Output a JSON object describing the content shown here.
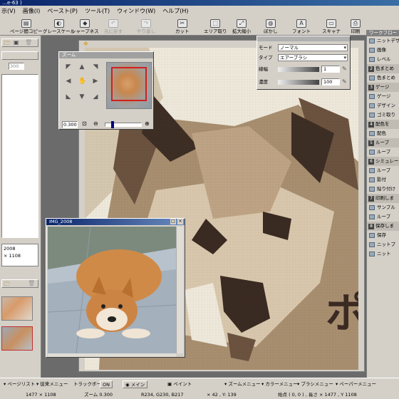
{
  "window": {
    "title": "…e-63 )"
  },
  "menu": [
    "示(V)",
    "画像(I)",
    "ペースト(P)",
    "ツール(T)",
    "ウィンドウ(W)",
    "ヘルプ(H)"
  ],
  "toolbar": {
    "buttons": [
      {
        "label": "ページ間コピー",
        "enabled": true
      },
      {
        "label": "グレースケール",
        "enabled": true
      },
      {
        "label": "シャープネス",
        "enabled": true
      },
      {
        "label": "元に戻す",
        "enabled": false
      },
      {
        "label": "やり直し",
        "enabled": false
      },
      {
        "label": "カット",
        "enabled": true
      },
      {
        "label": "エリア取り",
        "enabled": true
      },
      {
        "label": "拡大縮小",
        "enabled": true
      },
      {
        "label": "ぼかし",
        "enabled": true
      },
      {
        "label": "フォント",
        "enabled": true
      },
      {
        "label": "スキャナ",
        "enabled": true
      },
      {
        "label": "印刷",
        "enabled": true
      }
    ]
  },
  "left_panel": {
    "value": "300",
    "image_info_line1": "2008",
    "image_info_line2": "× 1108"
  },
  "zoom_window": {
    "title": "ズーム",
    "zoom_value": "0.300"
  },
  "brush_window": {
    "mode_label": "モード",
    "mode_value": "ノーマル",
    "type_label": "タイプ",
    "type_value": "エアーブラシ",
    "width_label": "線幅",
    "width_value": "1",
    "density_label": "濃度",
    "density_value": "100"
  },
  "photo_window": {
    "title": "IMG_2008"
  },
  "canvas": {
    "overlay_text": "ポ"
  },
  "right_panel": {
    "header": "ワークフロー",
    "items": [
      {
        "type": "item",
        "label": "ニットデザイン"
      },
      {
        "type": "item",
        "label": "画像"
      },
      {
        "type": "item",
        "label": "レベル"
      },
      {
        "type": "head",
        "num": "2",
        "label": "色まとめ"
      },
      {
        "type": "item",
        "label": "色まとめ"
      },
      {
        "type": "head",
        "num": "3",
        "label": "ゲージ"
      },
      {
        "type": "item",
        "label": "ゲージ"
      },
      {
        "type": "item",
        "label": "デザイン"
      },
      {
        "type": "item",
        "label": "ゴミ取り"
      },
      {
        "type": "head",
        "num": "4",
        "label": "配色を"
      },
      {
        "type": "item",
        "label": "配色"
      },
      {
        "type": "head",
        "num": "5",
        "label": "ループ"
      },
      {
        "type": "item",
        "label": "ループ"
      },
      {
        "type": "head",
        "num": "6",
        "label": "シミュレーション"
      },
      {
        "type": "item",
        "label": "ループ"
      },
      {
        "type": "item",
        "label": "影付"
      },
      {
        "type": "item",
        "label": "貼り付け"
      },
      {
        "type": "head",
        "num": "7",
        "label": "印刷しま"
      },
      {
        "type": "item",
        "label": "サンプル"
      },
      {
        "type": "item",
        "label": "ループ"
      },
      {
        "type": "head",
        "num": "8",
        "label": "保存しま"
      },
      {
        "type": "item",
        "label": "保存"
      },
      {
        "type": "item",
        "label": "ニットプ"
      },
      {
        "type": "item",
        "label": "ニット"
      }
    ]
  },
  "bottom_bar": {
    "buttons": [
      "ページリスト",
      "従来メニュー",
      "トラックボール",
      "ON",
      "メイン",
      "ペイント",
      "ズームメニュー",
      "カラーメニュー",
      "ブラシメニュー",
      "ペーパーメニュー"
    ],
    "size": "1477 × 1108",
    "zoom": "ズーム 0.300",
    "rgb": "R234, G230, B217",
    "xy": "× 42 , Y: 139",
    "start": "始点 ( 0, 0 ) , 長さ × 1477 , Y 1108"
  }
}
